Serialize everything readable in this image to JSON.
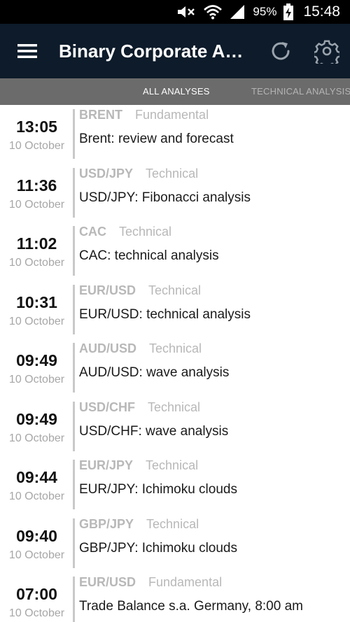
{
  "status_bar": {
    "battery_percent": "95%",
    "time": "15:48"
  },
  "app_bar": {
    "title": "Binary Corporate An…",
    "menu_icon": "hamburger-menu-icon",
    "refresh_icon": "refresh-icon",
    "settings_icon": "gear-icon"
  },
  "tabs": [
    {
      "label": "ALL ANALYSES",
      "active": true
    },
    {
      "label": "TECHNICAL ANALYSIS",
      "active": false
    }
  ],
  "items": [
    {
      "time": "13:05",
      "date": "10 October",
      "symbol": "BRENT",
      "kind": "Fundamental",
      "headline": "Brent: review and forecast"
    },
    {
      "time": "11:36",
      "date": "10 October",
      "symbol": "USD/JPY",
      "kind": "Technical",
      "headline": "USD/JPY: Fibonacci analysis"
    },
    {
      "time": "11:02",
      "date": "10 October",
      "symbol": "CAC",
      "kind": "Technical",
      "headline": "CAC: technical analysis"
    },
    {
      "time": "10:31",
      "date": "10 October",
      "symbol": "EUR/USD",
      "kind": "Technical",
      "headline": "EUR/USD: technical analysis"
    },
    {
      "time": "09:49",
      "date": "10 October",
      "symbol": "AUD/USD",
      "kind": "Technical",
      "headline": "AUD/USD: wave analysis"
    },
    {
      "time": "09:49",
      "date": "10 October",
      "symbol": "USD/CHF",
      "kind": "Technical",
      "headline": "USD/CHF: wave analysis"
    },
    {
      "time": "09:44",
      "date": "10 October",
      "symbol": "EUR/JPY",
      "kind": "Technical",
      "headline": "EUR/JPY: Ichimoku clouds"
    },
    {
      "time": "09:40",
      "date": "10 October",
      "symbol": "GBP/JPY",
      "kind": "Technical",
      "headline": "GBP/JPY: Ichimoku clouds"
    },
    {
      "time": "07:00",
      "date": "10 October",
      "symbol": "EUR/USD",
      "kind": "Fundamental",
      "headline": "Trade Balance s.a. Germany, 8:00 am"
    }
  ]
}
